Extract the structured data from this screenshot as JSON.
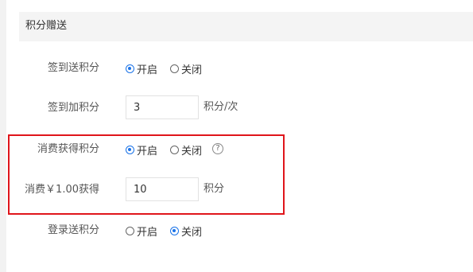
{
  "section": {
    "title": "积分赠送"
  },
  "rows": {
    "signin_points": {
      "label": "签到送积分",
      "options": [
        {
          "label": "开启",
          "selected": true
        },
        {
          "label": "关闭",
          "selected": false
        }
      ]
    },
    "signin_add": {
      "label": "签到加积分",
      "value": "3",
      "unit": "积分/次"
    },
    "consume_points": {
      "label": "消费获得积分",
      "options": [
        {
          "label": "开启",
          "selected": true
        },
        {
          "label": "关闭",
          "selected": false
        }
      ],
      "help_icon": "question-circle-icon",
      "help_glyph": "?"
    },
    "consume_rate": {
      "label": "消费￥1.00获得",
      "value": "10",
      "unit": "积分"
    },
    "login_points": {
      "label": "登录送积分",
      "options": [
        {
          "label": "开启",
          "selected": false
        },
        {
          "label": "关闭",
          "selected": true
        }
      ]
    }
  },
  "colors": {
    "accent": "#1a73e8",
    "highlight": "#e0151b"
  }
}
